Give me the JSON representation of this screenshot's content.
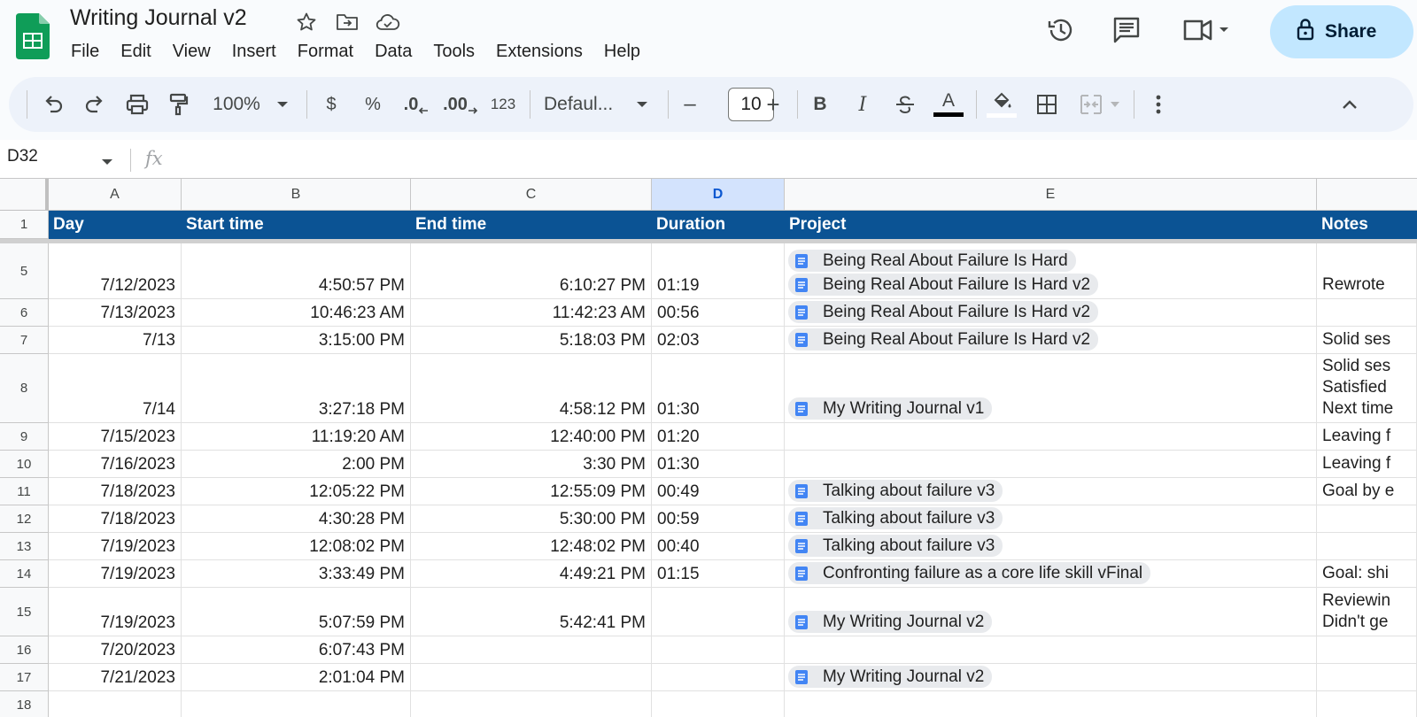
{
  "app": {
    "title": "Writing Journal v2",
    "menus": [
      "File",
      "Edit",
      "View",
      "Insert",
      "Format",
      "Data",
      "Tools",
      "Extensions",
      "Help"
    ],
    "share_label": "Share",
    "accent": "#0b5394",
    "share_bg": "#c2e7ff"
  },
  "toolbar": {
    "zoom": "100%",
    "currency": "$",
    "percent": "%",
    "dec_decrease": ".0",
    "dec_increase": ".00",
    "format_number": "123",
    "font": "Defaul...",
    "minus": "–",
    "font_size": "10",
    "plus": "+",
    "bold": "B",
    "italic": "I",
    "text_color_letter": "A"
  },
  "formula_bar": {
    "name_box": "D32",
    "fx": "fx",
    "value": ""
  },
  "columns": [
    "A",
    "B",
    "C",
    "D",
    "E"
  ],
  "header_row": {
    "row_num": "1",
    "cells": [
      "Day",
      "Start time",
      "End time",
      "Duration",
      "Project",
      "Notes"
    ]
  },
  "rows": [
    {
      "num": "5",
      "day": "7/12/2023",
      "start": "4:50:57 PM",
      "end": "6:10:27 PM",
      "duration": "01:19",
      "projects": [
        "Being Real About Failure Is Hard",
        "Being Real About Failure Is Hard v2"
      ],
      "notes": [
        "Rewrote"
      ]
    },
    {
      "num": "6",
      "day": "7/13/2023",
      "start": "10:46:23 AM",
      "end": "11:42:23 AM",
      "duration": "00:56",
      "projects": [
        "Being Real About Failure Is Hard v2"
      ],
      "notes": []
    },
    {
      "num": "7",
      "day": "7/13",
      "start": "3:15:00 PM",
      "end": "5:18:03 PM",
      "duration": "02:03",
      "projects": [
        "Being Real About Failure Is Hard v2"
      ],
      "notes": [
        "Solid ses"
      ]
    },
    {
      "num": "8",
      "day": "7/14",
      "start": "3:27:18 PM",
      "end": "4:58:12 PM",
      "duration": "01:30",
      "projects": [
        "My Writing Journal v1"
      ],
      "notes": [
        "Solid ses",
        "Satisfied",
        "Next time"
      ]
    },
    {
      "num": "9",
      "day": "7/15/2023",
      "start": "11:19:20 AM",
      "end": "12:40:00 PM",
      "duration": "01:20",
      "projects": [],
      "notes": [
        "Leaving f"
      ]
    },
    {
      "num": "10",
      "day": "7/16/2023",
      "start": "2:00 PM",
      "end": "3:30 PM",
      "duration": "01:30",
      "projects": [],
      "notes": [
        "Leaving f"
      ]
    },
    {
      "num": "11",
      "day": "7/18/2023",
      "start": "12:05:22 PM",
      "end": "12:55:09 PM",
      "duration": "00:49",
      "projects": [
        "Talking about failure v3"
      ],
      "notes": [
        "Goal by e"
      ]
    },
    {
      "num": "12",
      "day": "7/18/2023",
      "start": "4:30:28 PM",
      "end": "5:30:00 PM",
      "duration": "00:59",
      "projects": [
        "Talking about failure v3"
      ],
      "notes": []
    },
    {
      "num": "13",
      "day": "7/19/2023",
      "start": "12:08:02 PM",
      "end": "12:48:02 PM",
      "duration": "00:40",
      "projects": [
        "Talking about failure v3"
      ],
      "notes": []
    },
    {
      "num": "14",
      "day": "7/19/2023",
      "start": "3:33:49 PM",
      "end": "4:49:21 PM",
      "duration": "01:15",
      "projects": [
        "Confronting failure as a core life skill vFinal"
      ],
      "notes": [
        "Goal: shi"
      ]
    },
    {
      "num": "15",
      "day": "7/19/2023",
      "start": "5:07:59 PM",
      "end": "5:42:41 PM",
      "duration": "",
      "projects": [
        "My Writing Journal v2"
      ],
      "notes": [
        "Reviewin",
        "Didn't ge"
      ]
    },
    {
      "num": "16",
      "day": "7/20/2023",
      "start": "6:07:43 PM",
      "end": "",
      "duration": "",
      "projects": [],
      "notes": []
    },
    {
      "num": "17",
      "day": "7/21/2023",
      "start": "2:01:04 PM",
      "end": "",
      "duration": "",
      "projects": [
        "My Writing Journal v2"
      ],
      "notes": []
    },
    {
      "num": "18",
      "day": "",
      "start": "",
      "end": "",
      "duration": "",
      "projects": [],
      "notes": []
    }
  ]
}
